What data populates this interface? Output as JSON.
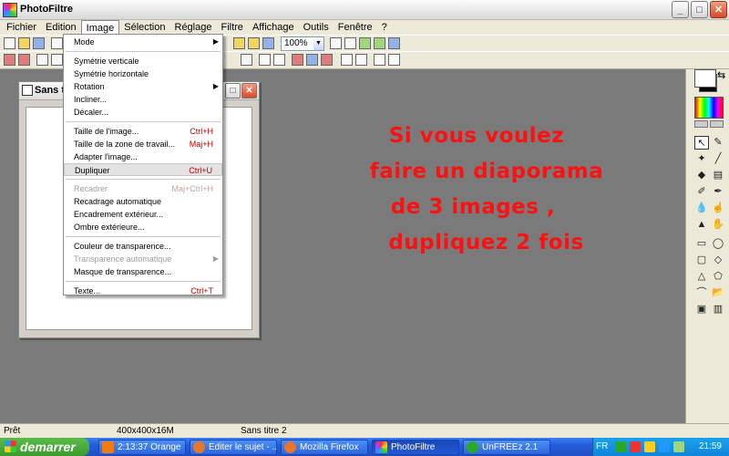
{
  "window": {
    "title": "PhotoFiltre"
  },
  "menubar": [
    "Fichier",
    "Edition",
    "Image",
    "Sélection",
    "Réglage",
    "Filtre",
    "Affichage",
    "Outils",
    "Fenêtre",
    "?"
  ],
  "toolbar": {
    "zoom": "100%"
  },
  "image_menu": [
    {
      "type": "item",
      "label": "Mode",
      "shortcut": "",
      "submenu": true,
      "disabled": false
    },
    {
      "type": "sep"
    },
    {
      "type": "item",
      "label": "Symétrie verticale",
      "shortcut": "",
      "submenu": false,
      "disabled": false
    },
    {
      "type": "item",
      "label": "Symétrie horizontale",
      "shortcut": "",
      "submenu": false,
      "disabled": false
    },
    {
      "type": "item",
      "label": "Rotation",
      "shortcut": "",
      "submenu": true,
      "disabled": false
    },
    {
      "type": "item",
      "label": "Incliner...",
      "shortcut": "",
      "submenu": false,
      "disabled": false
    },
    {
      "type": "item",
      "label": "Décaler...",
      "shortcut": "",
      "submenu": false,
      "disabled": false
    },
    {
      "type": "sep"
    },
    {
      "type": "item",
      "label": "Taille de l'image...",
      "shortcut": "Ctrl+H",
      "submenu": false,
      "disabled": false
    },
    {
      "type": "item",
      "label": "Taille de la zone de travail...",
      "shortcut": "Maj+H",
      "submenu": false,
      "disabled": false
    },
    {
      "type": "item",
      "label": "Adapter l'image...",
      "shortcut": "",
      "submenu": false,
      "disabled": false
    },
    {
      "type": "item",
      "label": "Dupliquer",
      "shortcut": "Ctrl+U",
      "submenu": false,
      "disabled": false,
      "highlighted": true
    },
    {
      "type": "sep"
    },
    {
      "type": "item",
      "label": "Recadrer",
      "shortcut": "Maj+Ctrl+H",
      "submenu": false,
      "disabled": true
    },
    {
      "type": "item",
      "label": "Recadrage automatique",
      "shortcut": "",
      "submenu": false,
      "disabled": false
    },
    {
      "type": "item",
      "label": "Encadrement extérieur...",
      "shortcut": "",
      "submenu": false,
      "disabled": false
    },
    {
      "type": "item",
      "label": "Ombre extérieure...",
      "shortcut": "",
      "submenu": false,
      "disabled": false
    },
    {
      "type": "sep"
    },
    {
      "type": "item",
      "label": "Couleur de transparence...",
      "shortcut": "",
      "submenu": false,
      "disabled": false
    },
    {
      "type": "item",
      "label": "Transparence automatique",
      "shortcut": "",
      "submenu": true,
      "disabled": true
    },
    {
      "type": "item",
      "label": "Masque de transparence...",
      "shortcut": "",
      "submenu": false,
      "disabled": false
    },
    {
      "type": "sep"
    },
    {
      "type": "item",
      "label": "Texte...",
      "shortcut": "Ctrl+T",
      "submenu": false,
      "disabled": false
    }
  ],
  "document": {
    "title": "Sans titre"
  },
  "overlay_text": [
    "Si vous voulez",
    "faire un diaporama",
    "de 3 images ,",
    "dupliquez 2 fois"
  ],
  "statusbar": {
    "state": "Prêt",
    "size": "400x400x16M",
    "doc": "Sans titre 2"
  },
  "taskbar": {
    "start": "demarrer",
    "tasks": [
      {
        "label": "2:13:37 Orange",
        "icon_color": "#f07a14"
      },
      {
        "label": "Editer le sujet - ...",
        "icon_color": "#e8762b"
      },
      {
        "label": "Mozilla Firefox",
        "icon_color": "#e8762b"
      },
      {
        "label": "PhotoFiltre",
        "icon_color": "#c43ac4",
        "active": true
      },
      {
        "label": "UnFREEz 2.1",
        "icon_color": "#2aa82a"
      }
    ],
    "lang": "FR",
    "clock": "21:59"
  },
  "colors": {
    "overlay_text": "#ff1010",
    "workspace": "#7a7a7a"
  }
}
